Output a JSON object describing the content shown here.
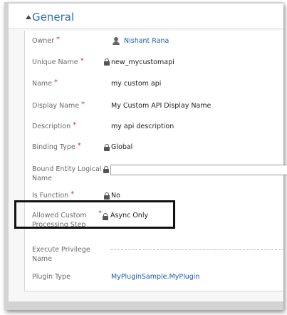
{
  "section": {
    "title": "General",
    "collapse_icon": "triangle-up-icon"
  },
  "fields": {
    "owner": {
      "label": "Owner",
      "required": "*",
      "value": "Nishant Rana"
    },
    "unique_name": {
      "label": "Unique Name",
      "required": "*",
      "value": "new_mycustomapi"
    },
    "name": {
      "label": "Name",
      "required": "*",
      "value": "my custom api"
    },
    "display_name": {
      "label": "Display Name",
      "required": "*",
      "value": "My Custom API Display Name"
    },
    "description": {
      "label": "Description",
      "required": "*",
      "value": "my api description"
    },
    "binding_type": {
      "label": "Binding Type",
      "required": "*",
      "value": "Global"
    },
    "bound_entity": {
      "label": "Bound Entity Logical Name",
      "value": ""
    },
    "is_function": {
      "label": "Is Function",
      "required": "*",
      "value": "No"
    },
    "allowed_custom_processing_step": {
      "label": "Allowed Custom Processing Step",
      "required": "*",
      "value": "Async Only"
    },
    "execute_privilege": {
      "label": "Execute Privilege Name",
      "value": ""
    },
    "plugin_type": {
      "label": "Plugin Type",
      "value": "MyPluginSample.MyPlugin"
    }
  },
  "colors": {
    "accent": "#2e6fb3",
    "link": "#1a5ea8",
    "required": "#d13438"
  }
}
